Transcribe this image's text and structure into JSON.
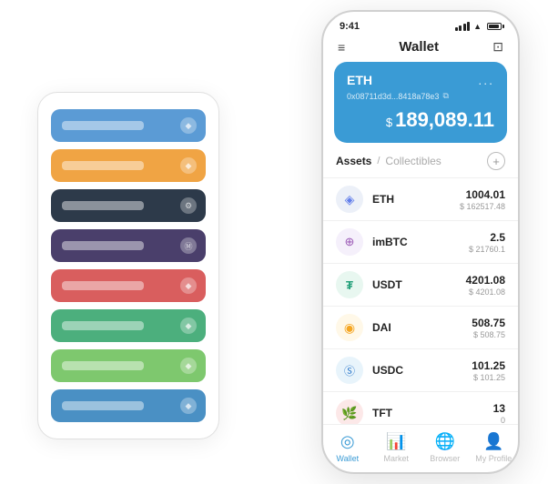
{
  "scene": {
    "cardStack": {
      "cards": [
        {
          "color": "card-blue",
          "icon": "◆"
        },
        {
          "color": "card-orange",
          "icon": "◆"
        },
        {
          "color": "card-dark",
          "icon": "⚙"
        },
        {
          "color": "card-purple",
          "icon": "Ⓜ"
        },
        {
          "color": "card-red",
          "icon": "◆"
        },
        {
          "color": "card-green",
          "icon": "◆"
        },
        {
          "color": "card-lightgreen",
          "icon": "◆"
        },
        {
          "color": "card-lightblue",
          "icon": "◆"
        }
      ]
    },
    "phone": {
      "statusBar": {
        "time": "9:41",
        "signalBars": [
          4,
          6,
          8,
          10
        ],
        "wifi": "wifi",
        "battery": 80
      },
      "header": {
        "menuIcon": "≡",
        "title": "Wallet",
        "scanIcon": "⊡"
      },
      "ethCard": {
        "title": "ETH",
        "moreIcon": "...",
        "address": "0x08711d3d...8418a78e3",
        "copyIcon": "⧉",
        "balanceSymbol": "$",
        "balance": "189,089.11"
      },
      "assets": {
        "activeTab": "Assets",
        "divider": "/",
        "inactiveTab": "Collectibles",
        "addIcon": "+",
        "rows": [
          {
            "icon": "◈",
            "iconBg": "eth-coin",
            "name": "ETH",
            "amount": "1004.01",
            "usd": "$ 162517.48"
          },
          {
            "icon": "⊕",
            "iconBg": "imbtc-coin",
            "name": "imBTC",
            "amount": "2.5",
            "usd": "$ 21760.1"
          },
          {
            "icon": "₮",
            "iconBg": "usdt-coin",
            "name": "USDT",
            "amount": "4201.08",
            "usd": "$ 4201.08"
          },
          {
            "icon": "◉",
            "iconBg": "dai-coin",
            "name": "DAI",
            "amount": "508.75",
            "usd": "$ 508.75"
          },
          {
            "icon": "Ⓢ",
            "iconBg": "usdc-coin",
            "name": "USDC",
            "amount": "101.25",
            "usd": "$ 101.25"
          },
          {
            "icon": "🌿",
            "iconBg": "tft-coin",
            "name": "TFT",
            "amount": "13",
            "usd": "0"
          }
        ]
      },
      "bottomNav": [
        {
          "icon": "◎",
          "label": "Wallet",
          "active": true
        },
        {
          "icon": "📈",
          "label": "Market",
          "active": false
        },
        {
          "icon": "🌐",
          "label": "Browser",
          "active": false
        },
        {
          "icon": "👤",
          "label": "My Profile",
          "active": false
        }
      ]
    }
  }
}
